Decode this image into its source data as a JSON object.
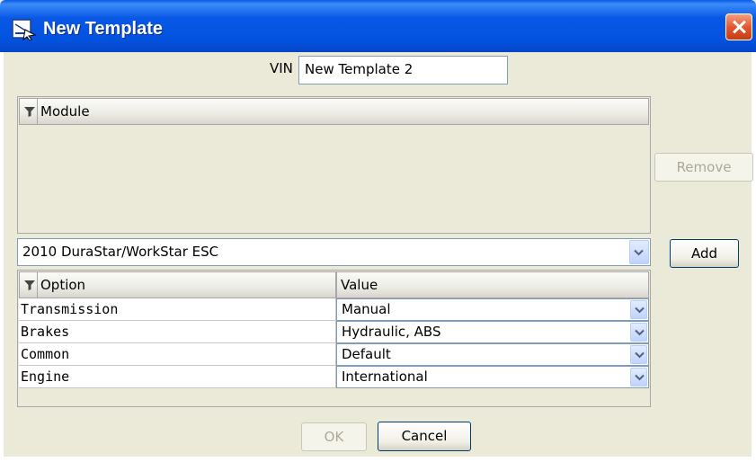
{
  "window": {
    "title": "New Template"
  },
  "vin": {
    "label": "VIN",
    "value": "New Template 2"
  },
  "module_table": {
    "column": "Module",
    "rows": []
  },
  "remove_button": "Remove",
  "module_select": {
    "selected": "2010 DuraStar/WorkStar ESC"
  },
  "add_button": "Add",
  "options_table": {
    "columns": [
      "Option",
      "Value"
    ],
    "rows": [
      {
        "option": "Transmission",
        "value": "Manual"
      },
      {
        "option": "Brakes",
        "value": "Hydraulic, ABS"
      },
      {
        "option": "Common",
        "value": "Default"
      },
      {
        "option": "Engine",
        "value": "International"
      }
    ]
  },
  "ok_button": "OK",
  "cancel_button": "Cancel",
  "icons": {
    "title": "template-window-icon",
    "filter": "filter-icon",
    "dropdown": "chevron-down-icon",
    "close": "close-icon"
  },
  "colors": {
    "titlebar": "#0353e0",
    "dialog_bg": "#ebe9d8",
    "close": "#e2532b",
    "field_border": "#7f9db9"
  }
}
